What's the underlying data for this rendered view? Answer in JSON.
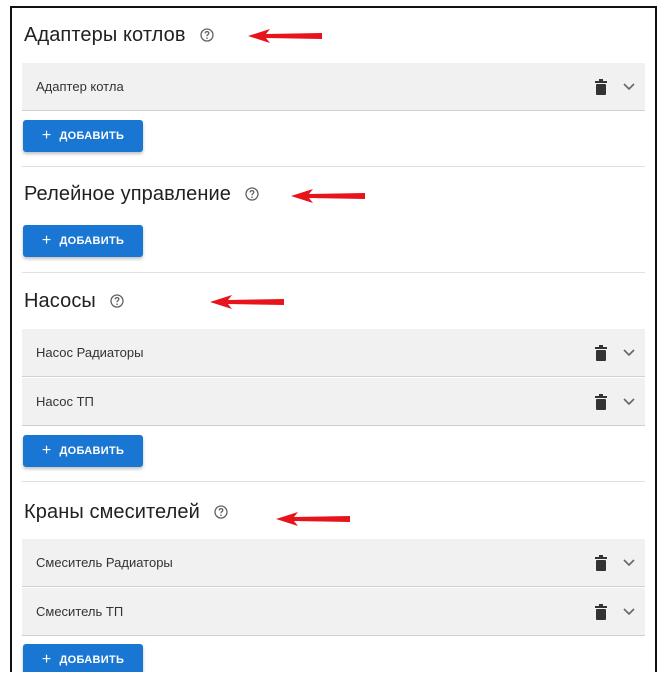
{
  "colors": {
    "accent": "#1976d2",
    "arrow": "#e8141b",
    "item_background": "#f1f1f1"
  },
  "sections": [
    {
      "title": "Адаптеры котлов",
      "items": [
        {
          "label": "Адаптер котла"
        }
      ],
      "add_label": "ДОБАВИТЬ"
    },
    {
      "title": "Релейное управление",
      "items": [],
      "add_label": "ДОБАВИТЬ"
    },
    {
      "title": "Насосы",
      "items": [
        {
          "label": "Насос Радиаторы"
        },
        {
          "label": "Насос ТП"
        }
      ],
      "add_label": "ДОБАВИТЬ"
    },
    {
      "title": "Краны смесителей",
      "items": [
        {
          "label": "Смеситель Радиаторы"
        },
        {
          "label": "Смеситель ТП"
        }
      ],
      "add_label": "ДОБАВИТЬ"
    }
  ],
  "icons": {
    "help": "help-circle-icon",
    "delete": "trash-icon",
    "expand": "chevron-down-icon",
    "add": "plus-icon",
    "pointer": "red-arrow-left"
  }
}
